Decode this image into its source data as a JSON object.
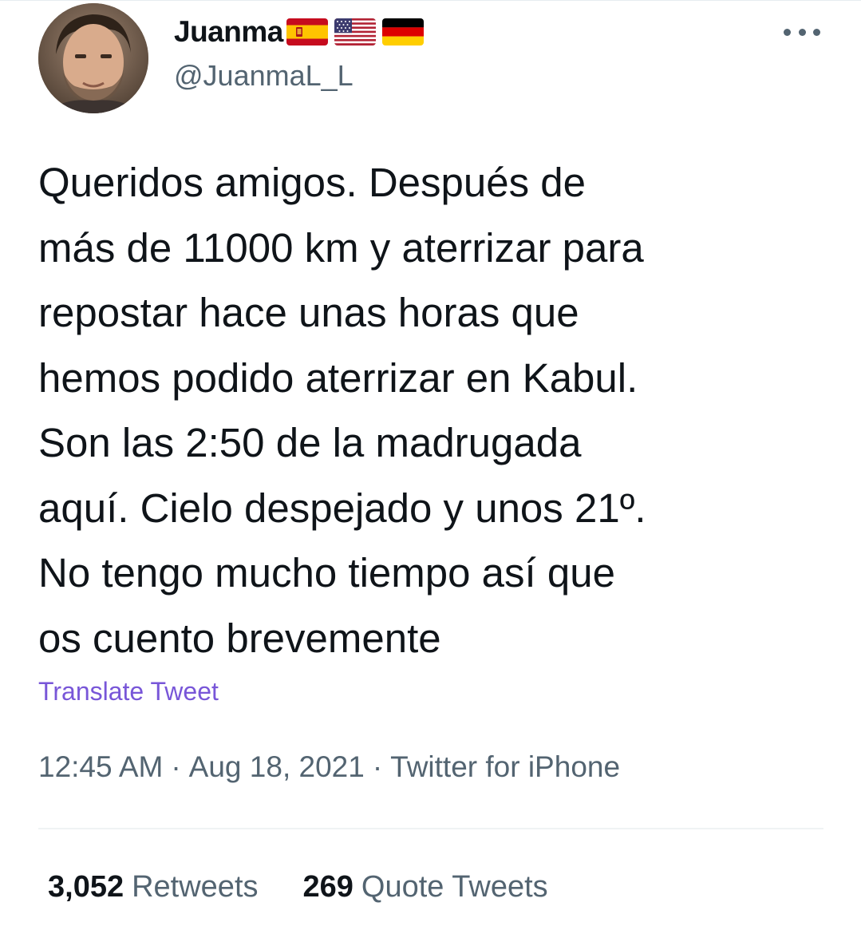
{
  "author": {
    "display_name": "Juanma",
    "handle": "@JuanmaL_L",
    "flags": [
      "spain-flag",
      "usa-flag",
      "germany-flag"
    ]
  },
  "tweet": {
    "text": "Queridos amigos. Después de\nmás de 11000 km y aterrizar para\nrepostar hace unas horas que\nhemos podido aterrizar en Kabul.\nSon las 2:50 de la madrugada\naquí. Cielo despejado y unos 21º.\nNo tengo mucho tiempo así que\nos cuento brevemente",
    "translate_label": "Translate Tweet",
    "time": "12:45 AM",
    "date": "Aug 18, 2021",
    "source": "Twitter for iPhone",
    "separator": "·"
  },
  "stats": {
    "retweets_count": "3,052",
    "retweets_label": "Retweets",
    "quotes_count": "269",
    "quotes_label": "Quote Tweets"
  },
  "colors": {
    "text": "#0f1419",
    "secondary": "#536471",
    "translate_link": "#7856d8",
    "divider": "#eff3f4"
  }
}
